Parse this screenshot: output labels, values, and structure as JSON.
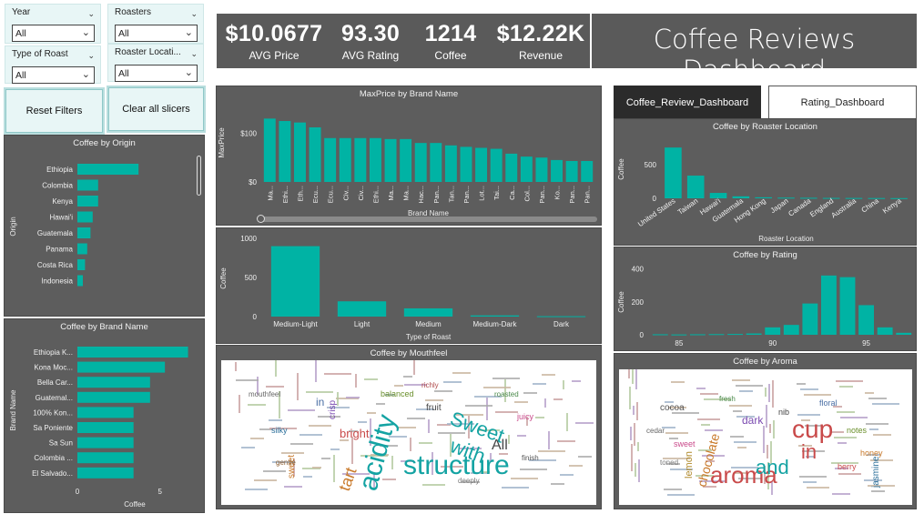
{
  "app_title": "Coffee Reviews Dashboard",
  "colors": {
    "bar": "#00b3a4",
    "panel": "#5d5d5d",
    "kpi_bg": "#5a5a5a",
    "slicer_bg": "#e8f6f6",
    "dark_tab": "#2b2b2b"
  },
  "slicers": {
    "year": {
      "label": "Year",
      "value": "All"
    },
    "roasters": {
      "label": "Roasters",
      "value": "All"
    },
    "type_of_roast": {
      "label": "Type of Roast",
      "value": "All"
    },
    "roaster_location": {
      "label": "Roaster Locati...",
      "value": "All"
    }
  },
  "buttons": {
    "reset": "Reset Filters",
    "clear": "Clear all slicers"
  },
  "kpis": [
    {
      "value": "$10.0677",
      "label": "AVG Price"
    },
    {
      "value": "93.30",
      "label": "AVG Rating"
    },
    {
      "value": "1214",
      "label": "Coffee"
    },
    {
      "value": "$12.22K",
      "label": "Revenue"
    }
  ],
  "tabs": {
    "active": "Coffee_Review_Dashboard",
    "other": "Rating_Dashboard"
  },
  "titles": {
    "origin": "Coffee by Origin",
    "brand": "Coffee by Brand Name",
    "maxprice": "MaxPrice by Brand Name",
    "roast": "Coffee",
    "mouthfeel": "Coffee by Mouthfeel",
    "location": "Coffee by Roaster Location",
    "rating": "Coffee by Rating",
    "aroma": "Coffee by Aroma"
  },
  "chart_data": [
    {
      "id": "origin",
      "type": "bar",
      "orientation": "horizontal",
      "title": "Coffee by Origin",
      "ylabel": "Origin",
      "xlabel": "",
      "categories": [
        "Ethiopia",
        "Colombia",
        "Kenya",
        "Hawai'i",
        "Guatemala",
        "Panama",
        "Costa Rica",
        "Indonesia"
      ],
      "values": [
        280,
        95,
        95,
        70,
        60,
        45,
        35,
        25
      ],
      "xlim": [
        0,
        500
      ]
    },
    {
      "id": "brand",
      "type": "bar",
      "orientation": "horizontal",
      "title": "Coffee by Brand Name",
      "ylabel": "Brand Name",
      "xlabel": "Coffee",
      "categories": [
        "Ethiopia K...",
        "Kona Moc...",
        "Bella Car...",
        "Guatemal...",
        "100% Kon...",
        "Sa Poniente",
        "Sa Sun",
        "Colombia ...",
        "El Salvado..."
      ],
      "values": [
        6.7,
        5.3,
        4.4,
        4.4,
        3.4,
        3.4,
        3.4,
        3.4,
        3.4
      ],
      "xticks": [
        "0",
        "5"
      ],
      "xlim": [
        0,
        7
      ]
    },
    {
      "id": "maxprice",
      "type": "bar",
      "title": "MaxPrice by Brand Name",
      "ylabel": "MaxPrice",
      "xlabel": "Brand Name",
      "categories": [
        "Ma...",
        "Ethi...",
        "Eth...",
        "Ecu...",
        "Ecu...",
        "Civ...",
        "Civ...",
        "Ethi...",
        "Ma...",
        "Ma...",
        "Hac...",
        "Pan...",
        "Tan...",
        "Pan...",
        "Lot...",
        "Tai...",
        "Ca...",
        "Col...",
        "Pan...",
        "Ko...",
        "Pan...",
        "Pan..."
      ],
      "values": [
        130,
        125,
        122,
        112,
        90,
        90,
        90,
        90,
        88,
        88,
        80,
        80,
        75,
        72,
        70,
        68,
        58,
        52,
        50,
        45,
        43,
        43
      ],
      "yticks": [
        "$0",
        "$100"
      ],
      "ylim": [
        0,
        140
      ]
    },
    {
      "id": "roast",
      "type": "bar",
      "title": "Coffee",
      "ylabel": "Coffee",
      "xlabel": "Type of Roast",
      "categories": [
        "Medium-Light",
        "Light",
        "Medium",
        "Medium-Dark",
        "Dark"
      ],
      "values": [
        900,
        195,
        105,
        15,
        5
      ],
      "yticks": [
        "0",
        "500",
        "1000"
      ],
      "ylim": [
        0,
        1000
      ]
    },
    {
      "id": "location",
      "type": "bar",
      "title": "Coffee by Roaster Location",
      "ylabel": "Coffee",
      "xlabel": "Roaster Location",
      "categories": [
        "United States",
        "Taiwan",
        "Hawai'i",
        "Guatemala",
        "Hong Kong",
        "Japan",
        "Canada",
        "England",
        "Australia",
        "China",
        "Kenya"
      ],
      "values": [
        750,
        335,
        80,
        30,
        15,
        10,
        8,
        6,
        5,
        4,
        3
      ],
      "yticks": [
        "0",
        "500"
      ],
      "ylim": [
        0,
        900
      ]
    },
    {
      "id": "rating",
      "type": "bar",
      "title": "Coffee by Rating",
      "ylabel": "Coffee",
      "xlabel": "",
      "x": [
        84,
        85,
        86,
        87,
        88,
        89,
        90,
        91,
        92,
        93,
        94,
        95,
        96,
        97
      ],
      "values": [
        3,
        2,
        3,
        4,
        5,
        8,
        45,
        60,
        190,
        360,
        350,
        180,
        45,
        12
      ],
      "xticks": [
        "85",
        "90",
        "95"
      ],
      "yticks": [
        "0",
        "200",
        "400"
      ],
      "ylim": [
        0,
        420
      ]
    }
  ],
  "mouthfeel_words": [
    {
      "t": "acidity",
      "c": "#14a3a3",
      "r": -75
    },
    {
      "t": "structure",
      "c": "#14a3a3",
      "r": 0
    },
    {
      "t": "Sweet",
      "c": "#14a3a3",
      "r": 20
    },
    {
      "t": "with",
      "c": "#14a3a3",
      "r": 20
    },
    {
      "t": "tart",
      "c": "#c97a2b",
      "r": -70
    },
    {
      "t": "in",
      "c": "#4a6fa5",
      "r": 0
    },
    {
      "t": "bright",
      "c": "#c94a4a",
      "r": 0
    },
    {
      "t": "All",
      "c": "#444",
      "r": 0
    },
    {
      "t": "crisp",
      "c": "#7a4ab0",
      "r": -90
    },
    {
      "t": "fruit",
      "c": "#444",
      "r": 0
    },
    {
      "t": "sweet",
      "c": "#c97a2b",
      "r": -90
    },
    {
      "t": "balanced",
      "c": "#6a8f2b",
      "r": 0
    },
    {
      "t": "juicy",
      "c": "#c94a8a",
      "r": 0
    },
    {
      "t": "silky",
      "c": "#2b6f9a",
      "r": 0
    },
    {
      "t": "mouthfeel",
      "c": "#666",
      "r": 0
    },
    {
      "t": "richly",
      "c": "#b04a4a",
      "r": 0
    },
    {
      "t": "deeply",
      "c": "#777",
      "r": 0
    },
    {
      "t": "finish",
      "c": "#555",
      "r": 0
    },
    {
      "t": "gentle",
      "c": "#8a5a2b",
      "r": 0
    },
    {
      "t": "roasted",
      "c": "#4a8a4a",
      "r": 0
    }
  ],
  "aroma_words": [
    {
      "t": "cup",
      "c": "#c94a4a",
      "r": 0
    },
    {
      "t": "in",
      "c": "#c94a4a",
      "r": 0
    },
    {
      "t": "aroma",
      "c": "#c94a4a",
      "r": 0
    },
    {
      "t": "and",
      "c": "#14a3a3",
      "r": 0
    },
    {
      "t": "chocolate",
      "c": "#c97a2b",
      "r": -75
    },
    {
      "t": "cocoa",
      "c": "#555",
      "r": 0
    },
    {
      "t": "dark",
      "c": "#7a4ab0",
      "r": 0
    },
    {
      "t": "floral",
      "c": "#4a6fa5",
      "r": 0
    },
    {
      "t": "sweet",
      "c": "#c94a8a",
      "r": 0
    },
    {
      "t": "notes",
      "c": "#6a8f2b",
      "r": 0
    },
    {
      "t": "lemon",
      "c": "#b08a2b",
      "r": -90
    },
    {
      "t": "berry",
      "c": "#c94a4a",
      "r": 0
    },
    {
      "t": "nib",
      "c": "#444",
      "r": 0
    },
    {
      "t": "cedar",
      "c": "#666",
      "r": 0
    },
    {
      "t": "honey",
      "c": "#c97a2b",
      "r": 0
    },
    {
      "t": "jasmine",
      "c": "#2b6f9a",
      "r": -90
    },
    {
      "t": "fresh",
      "c": "#4a8a4a",
      "r": 0
    },
    {
      "t": "toned",
      "c": "#777",
      "r": 0
    }
  ]
}
